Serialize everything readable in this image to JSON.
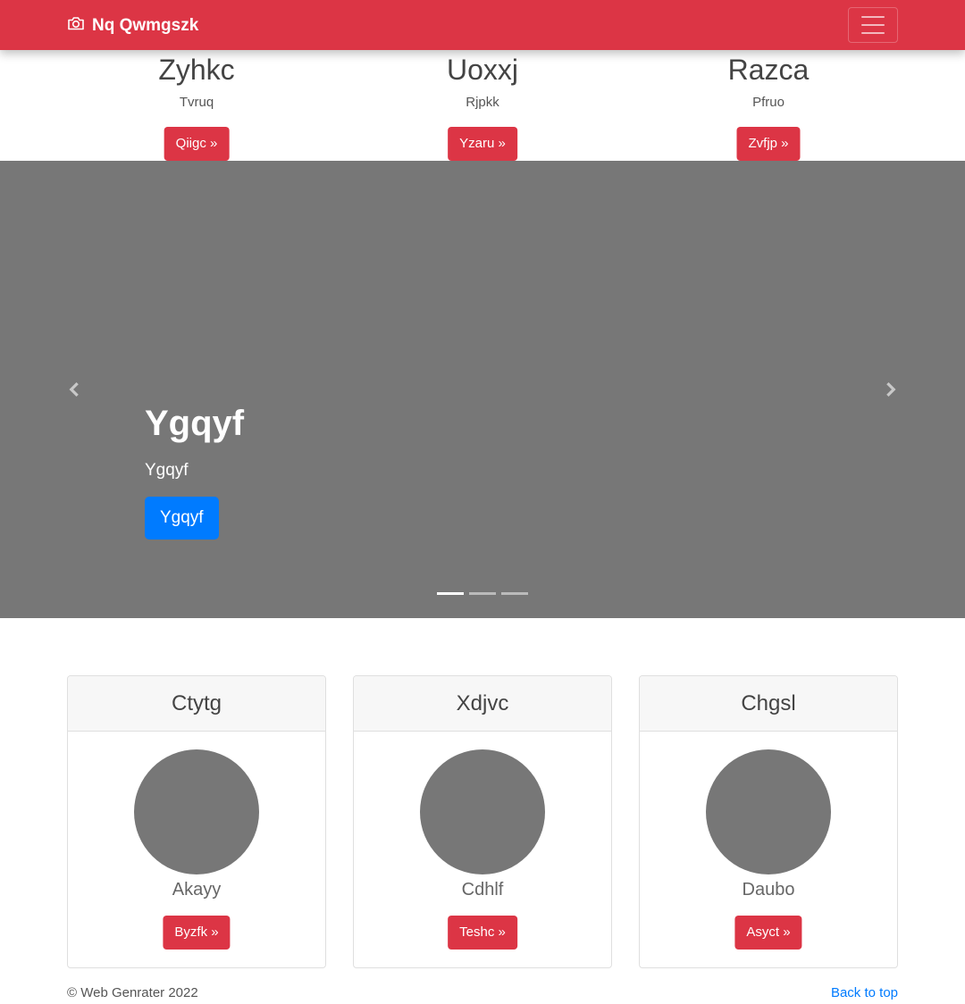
{
  "navbar": {
    "brand": "Nq Qwmgszk",
    "brand_icon": "camera-icon",
    "toggler_icon": "hamburger-menu-icon",
    "color": "#dc3545"
  },
  "features": [
    {
      "title": "Zyhkc",
      "text": "Tvruq",
      "button": "Qiigc »"
    },
    {
      "title": "Uoxxj",
      "text": "Rjpkk",
      "button": "Yzaru »"
    },
    {
      "title": "Razca",
      "text": "Pfruo",
      "button": "Zvfjp »"
    }
  ],
  "carousel": {
    "title": "Ygqyf",
    "subtitle": "Ygqyf",
    "button": "Ygqyf",
    "prev_icon": "chevron-left-icon",
    "next_icon": "chevron-right-icon",
    "slides": 3,
    "active_slide": 1,
    "background": "#777777"
  },
  "cards": [
    {
      "header": "Ctytg",
      "name": "Akayy",
      "button": "Byzfk »"
    },
    {
      "header": "Xdjvc",
      "name": "Cdhlf",
      "button": "Teshc »"
    },
    {
      "header": "Chgsl",
      "name": "Daubo",
      "button": "Asyct »"
    }
  ],
  "footer": {
    "copyright": "© Web Genrater 2022",
    "back_to_top": "Back to top"
  },
  "colors": {
    "accent_red": "#dc3545",
    "primary_blue": "#007bff"
  }
}
